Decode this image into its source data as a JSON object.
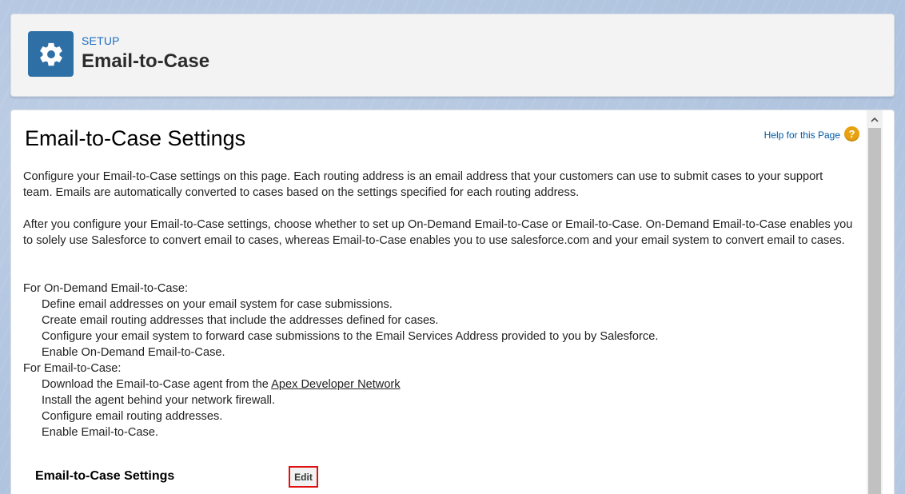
{
  "header": {
    "eyebrow": "SETUP",
    "title": "Email-to-Case",
    "icon": "gear-icon",
    "icon_bg": "#2e6fa6"
  },
  "page": {
    "heading": "Email-to-Case Settings",
    "help_link": "Help for this Page",
    "help_icon_glyph": "?",
    "paragraph1": "Configure your Email-to-Case settings on this page. Each routing address is an email address that your customers can use to submit cases to your support team. Emails are automatically converted to cases based on the settings specified for each routing address.",
    "paragraph2": "After you configure your Email-to-Case settings, choose whether to set up On-Demand Email-to-Case or Email-to-Case. On-Demand Email-to-Case enables you to solely use Salesforce to convert email to cases, whereas Email-to-Case enables you to use salesforce.com and your email system to convert email to cases.",
    "on_demand": {
      "heading": "For On-Demand Email-to-Case:",
      "steps": [
        "Define email addresses on your email system for case submissions.",
        "Create email routing addresses that include the addresses defined for cases.",
        "Configure your email system to forward case submissions to the Email Services Address provided to you by Salesforce.",
        "Enable On-Demand Email-to-Case."
      ]
    },
    "email_to_case": {
      "heading": "For Email-to-Case:",
      "step1_prefix": "Download the Email-to-Case agent from the ",
      "step1_link": "Apex Developer Network",
      "steps": [
        "Install the agent behind your network firewall.",
        "Configure email routing addresses.",
        "Enable Email-to-Case."
      ]
    },
    "section_label": "Email-to-Case Settings",
    "edit_label": "Edit"
  },
  "colors": {
    "link": "#015ba7",
    "help_icon": "#e8a210",
    "edit_highlight": "#e01010"
  }
}
